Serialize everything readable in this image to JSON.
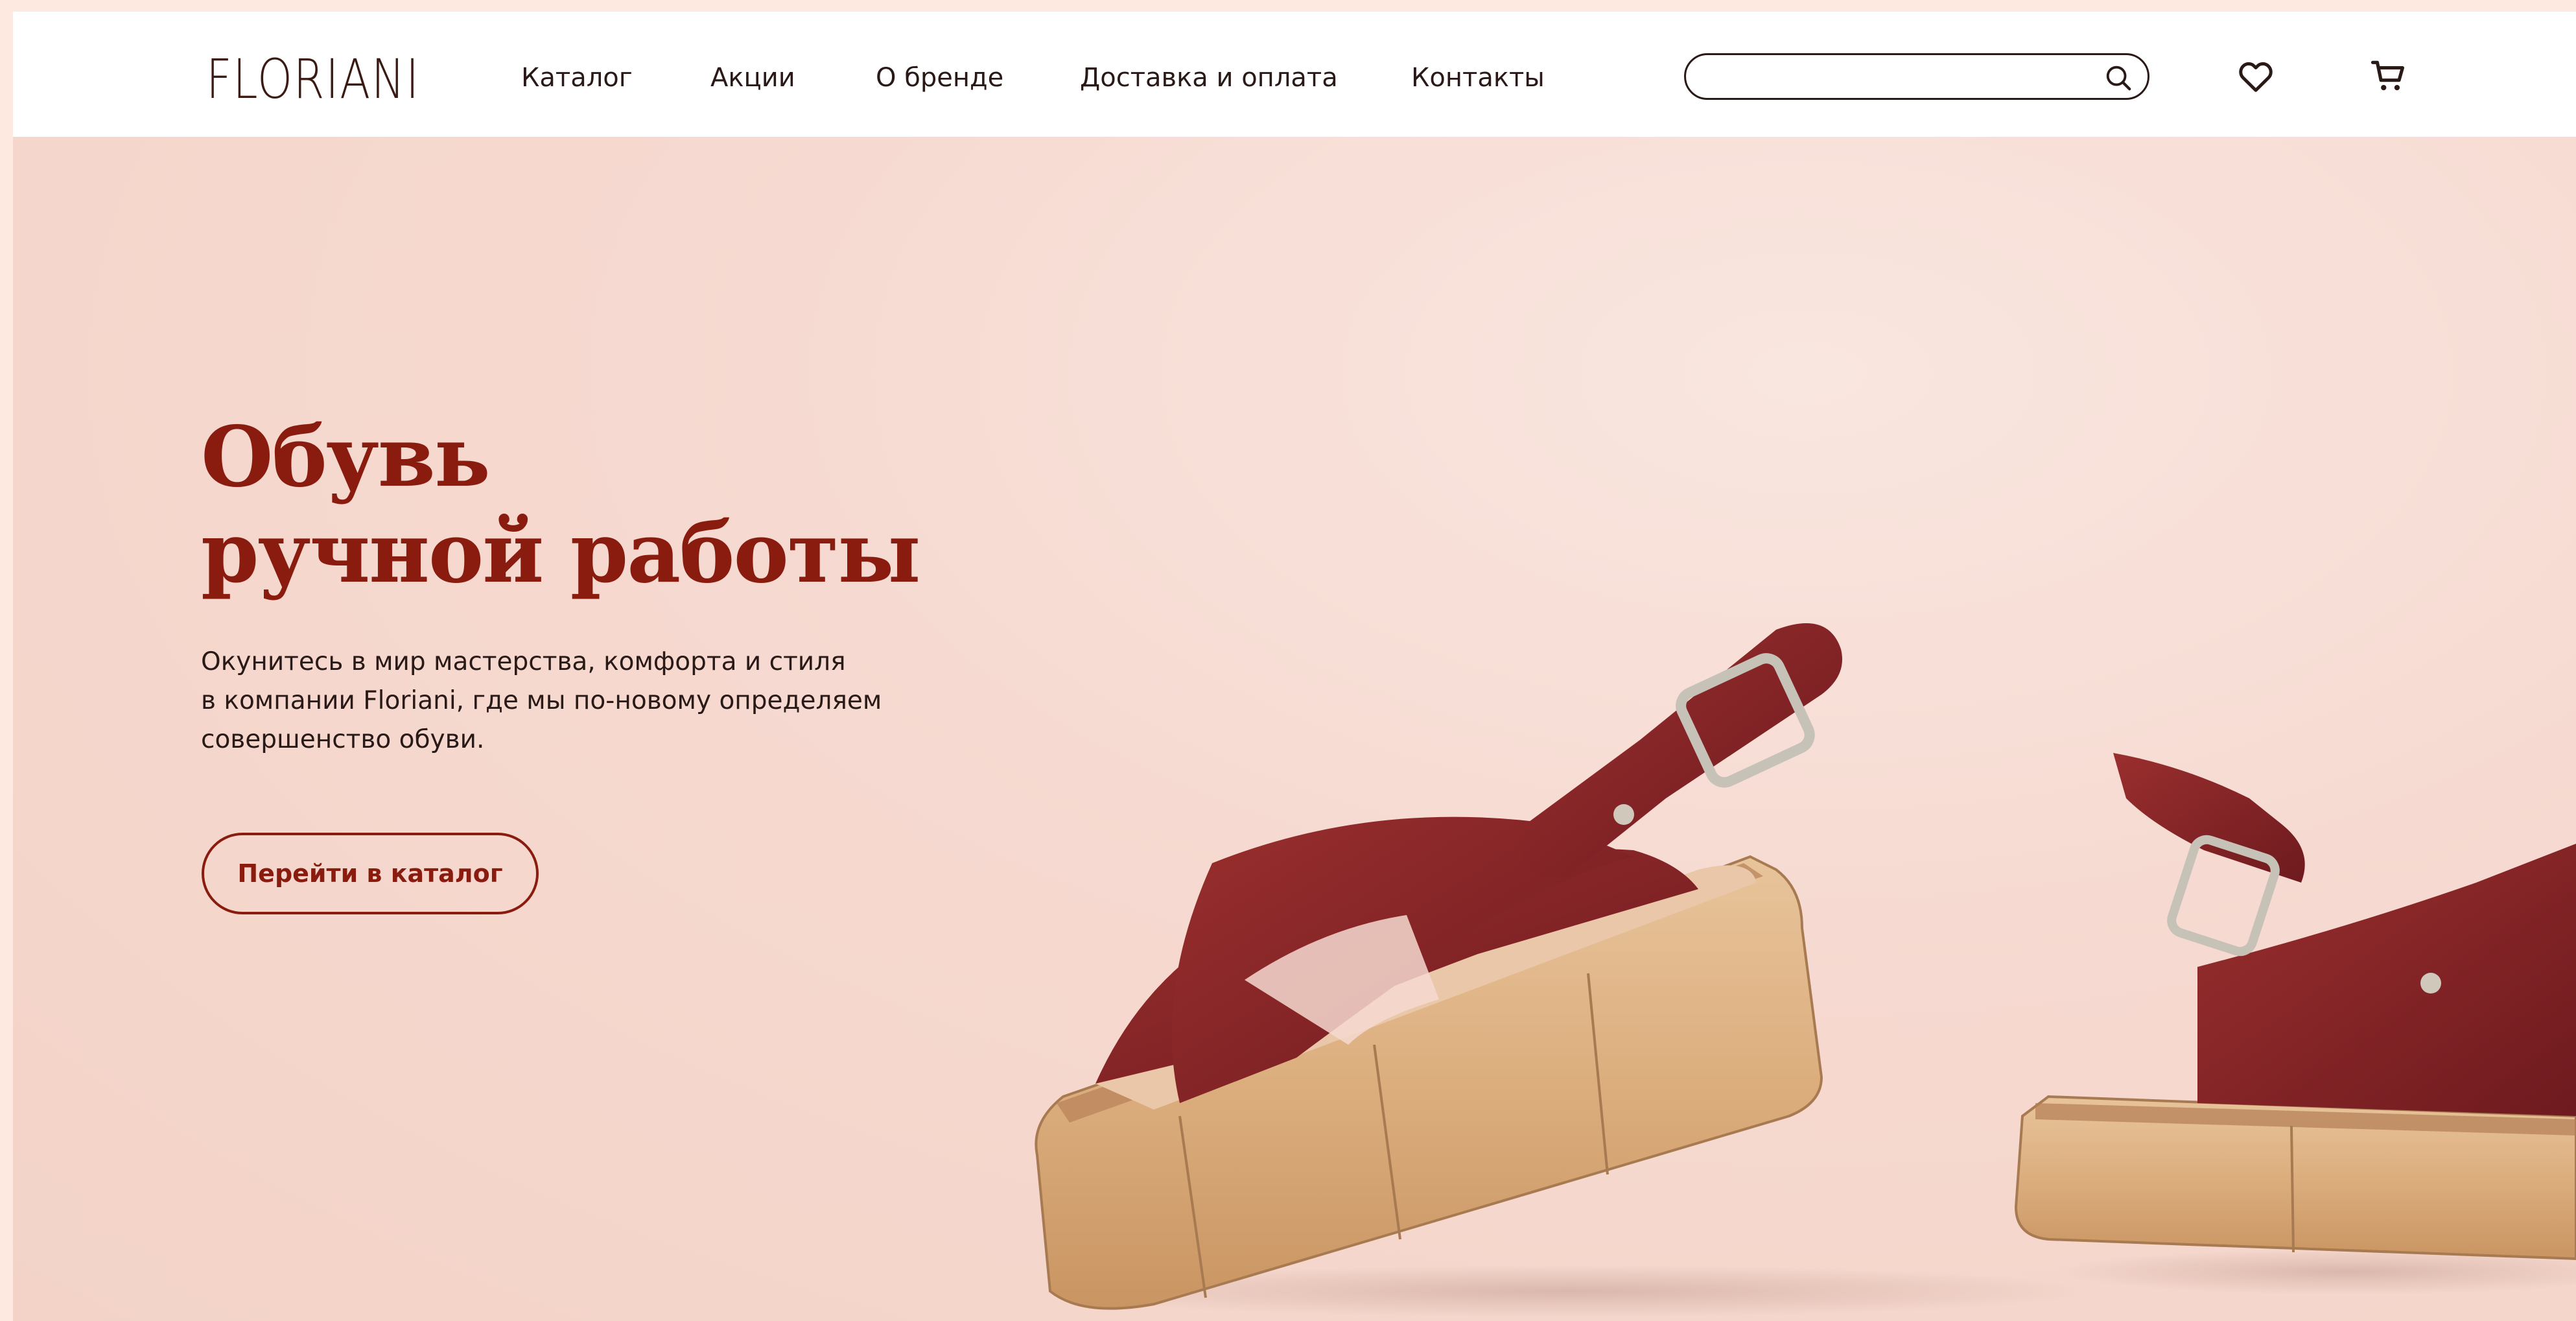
{
  "header": {
    "logo": "FLORIANI",
    "nav": [
      {
        "label": "Каталог"
      },
      {
        "label": "Акции"
      },
      {
        "label": "О бренде"
      },
      {
        "label": "Доставка и оплата"
      },
      {
        "label": "Контакты"
      }
    ],
    "search": {
      "value": "",
      "placeholder": ""
    },
    "icons": {
      "search": "search-icon",
      "favorites": "heart-icon",
      "cart": "cart-icon"
    }
  },
  "hero": {
    "title_line1": "Обувь",
    "title_line2": "ручной работы",
    "text_line1": "Окунитесь в мир мастерства, комфорта и стиля",
    "text_line2": "в компании Floriani, где мы по-новому определяем",
    "text_line3": "совершенство обуви.",
    "cta_label": "Перейти в каталог"
  },
  "colors": {
    "accent": "#8a1c0f",
    "text": "#2a1a17",
    "background": "#f7ddd6",
    "header_bg": "#ffffff"
  }
}
